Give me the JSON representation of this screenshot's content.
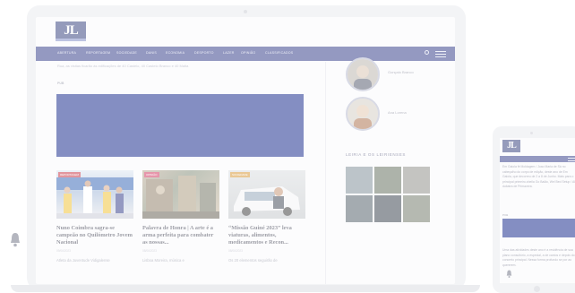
{
  "desktop": {
    "logo_text": "JL",
    "nav": {
      "items": [
        "ABERTURA",
        "REPORTAGEM",
        "SOCIEDADE",
        "DANIS",
        "ECONOMIA",
        "DESPORTO",
        "LAZER",
        "OPINIÃO",
        "CLASSIFICADOS"
      ],
      "search_icon": "search-icon",
      "menu_icon": "hamburger-icon"
    },
    "top_line": "Rua, as visitas ficarão às edificações de 40 Castelo, 40 Castelo Branco e 40 Malta",
    "ad_label": "PUB",
    "banner_color": "#0b1f86",
    "cards": [
      {
        "tag": "REPORTAGEM",
        "tag_color": "#c62f3f",
        "title": "Nuno Coimbra sagra-se campeão no Quilómetro Jovem Nacional",
        "date": "09/06/2023",
        "excerpt": "Atleta da Juventude Vidigalense"
      },
      {
        "tag": "OPINIÃO",
        "tag_color": "#cf2f5a",
        "title": "Palavra de Honra | A arte é a arma perfeita para combater as nossas...",
        "date": "08/06/2023",
        "excerpt": "Lisboa Moreira, música e"
      },
      {
        "tag": "SOCIEDADE",
        "tag_color": "#d7922e",
        "title": "“Missão Guiné 2023” leva viaturas, alimentos, medicamentos e Recon...",
        "date": "08/06/2023",
        "excerpt": "Os 20 elementos seguirão de"
      }
    ],
    "sidebar": {
      "authors": [
        "Gonçalo Branco",
        "Ana Lorena"
      ],
      "section_title": "LEIRIA E OS LEIRIENSES"
    }
  },
  "mobile": {
    "logo_text": "JL",
    "menu_icon": "hamburger-icon",
    "intro_text": "Em Gaiola fé Moldagem / Joao Maria de Sá no cabeçalho do corpo de edição, deste ano de Em Gaiola, que decorreu de 2 a 8 de Junho. Mais para o principal primeiro-sheila Go Baião, Wel Bed Setup / Al dubatra de Primavera.",
    "ad_label": "PUB",
    "lower_text": "Uma das atividades deste ano é a residência de sua plano consultório, a especial, a de cantos e depois do concerto principal. Nessa forma profundo se por ao quererem."
  }
}
